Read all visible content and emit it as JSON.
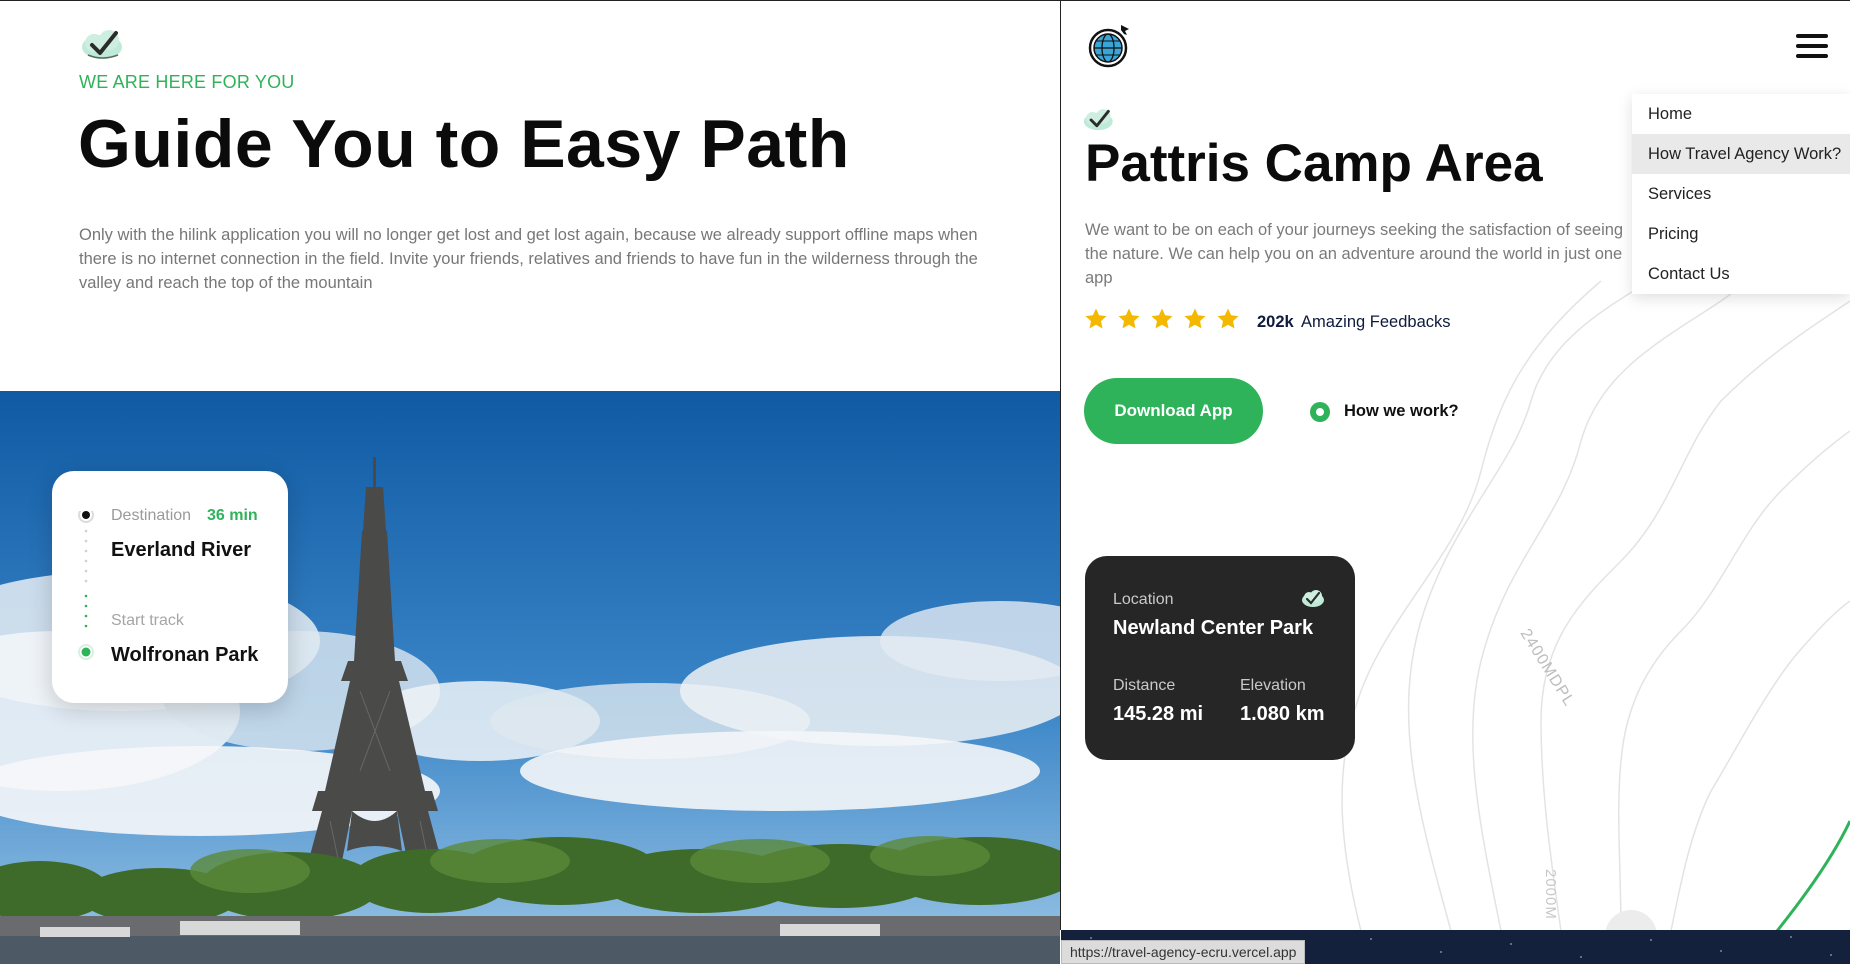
{
  "left": {
    "eyebrow": "WE ARE HERE FOR YOU",
    "title": "Guide You to Easy Path",
    "description": "Only with the hilink application you will no longer get lost and get lost again, because we already support offline maps when there is no internet connection in the field. Invite your friends, relatives and friends to have fun in the wilderness through the valley and reach the top of the mountain",
    "route_card": {
      "destination_label": "Destination",
      "eta": "36 min",
      "destination": "Everland River",
      "start_label": "Start track",
      "start": "Wolfronan Park"
    }
  },
  "right": {
    "title": "Pattris Camp Area",
    "description": "We want to be on each of your journeys seeking the satisfaction of seeing the nature. We can help you on an adventure around the world in just one app",
    "rating": {
      "stars": 5,
      "count": "202k",
      "label": "Amazing Feedbacks"
    },
    "download_label": "Download App",
    "how_label": "How we work?",
    "location_card": {
      "location_label": "Location",
      "location": "Newland Center Park",
      "distance_label": "Distance",
      "distance": "145.28 mi",
      "elevation_label": "Elevation",
      "elevation": "1.080 km"
    },
    "topo_labels": [
      "2400MDPL",
      "2000M"
    ],
    "menu": {
      "items": [
        "Home",
        "How Travel Agency Work?",
        "Services",
        "Pricing",
        "Contact Us"
      ],
      "active": "How Travel Agency Work?"
    }
  },
  "status_bar": {
    "url": "https://travel-agency-ecru.vercel.app"
  },
  "colors": {
    "accent": "#2fb35a",
    "dark_card": "#262626",
    "star": "#f5b800",
    "text": "#0b0b0b",
    "muted": "#777777"
  },
  "icons": [
    "cloud-check-icon",
    "globe-plane-icon",
    "hamburger-icon",
    "star-icon",
    "play-circle-icon"
  ]
}
